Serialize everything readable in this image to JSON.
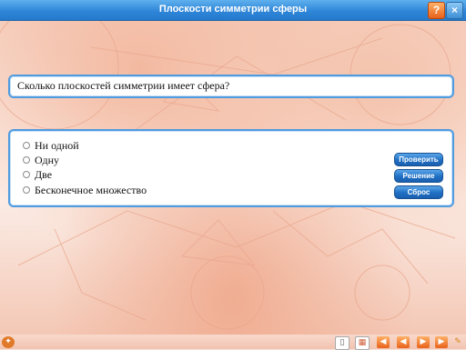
{
  "window": {
    "title": "Плоскости симметрии сферы"
  },
  "toolbar": {
    "help_label": "?",
    "close_label": "×"
  },
  "question": {
    "text": "Сколько плоскостей симметрии имеет сфера?"
  },
  "options": [
    {
      "label": "Ни одной",
      "selected": false
    },
    {
      "label": "Одну",
      "selected": false
    },
    {
      "label": "Две",
      "selected": false
    },
    {
      "label": "Бесконечное множество",
      "selected": false
    }
  ],
  "actions": {
    "check_label": "Проверить",
    "solution_label": "Решение",
    "reset_label": "Сброс"
  },
  "colors": {
    "titlebar": "#2f86d8",
    "panel_border": "#4f9be0",
    "button": "#1f6fc4",
    "help_button": "#e8621c",
    "background": "#f6e2d8"
  },
  "bottom_icons": [
    "sheet-icon",
    "grid-icon",
    "nav-first-icon",
    "nav-prev-icon",
    "nav-next-icon",
    "nav-last-icon",
    "pencil-icon"
  ],
  "corner_icon": "logo-icon"
}
